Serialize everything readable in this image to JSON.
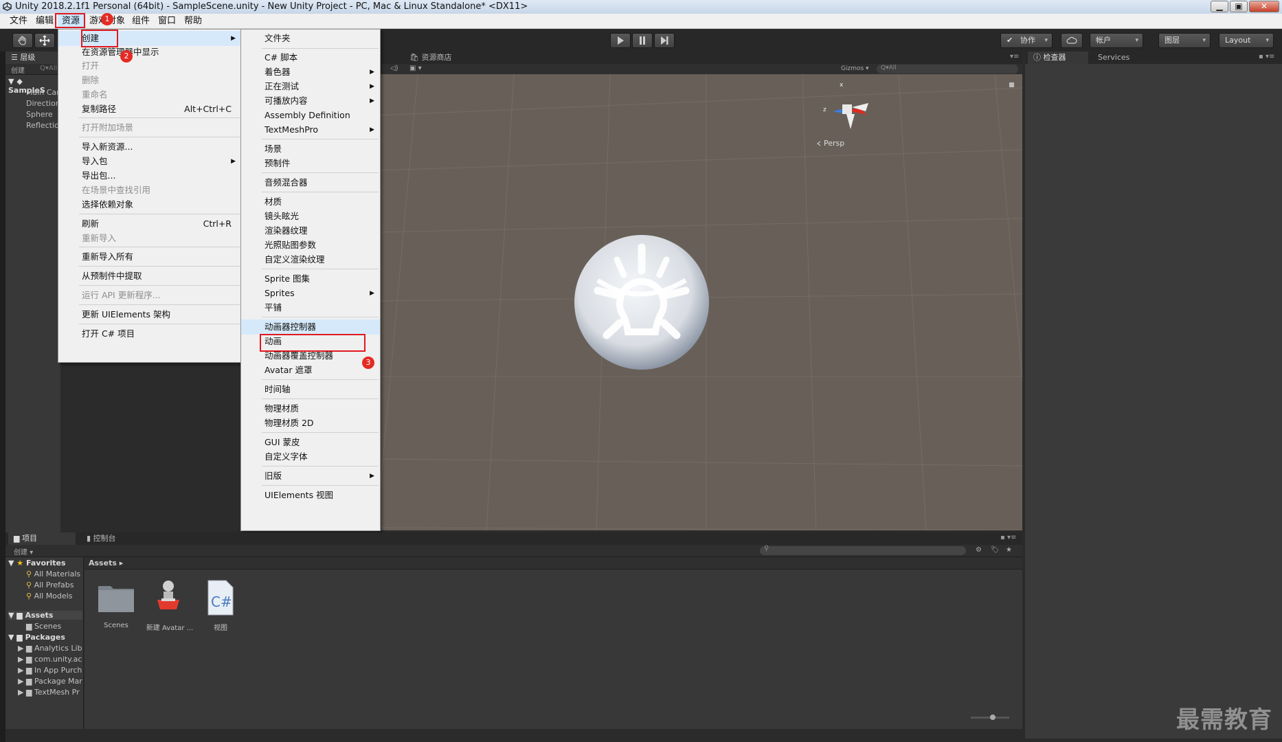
{
  "window": {
    "title": "Unity 2018.2.1f1 Personal (64bit) - SampleScene.unity - New Unity Project - PC, Mac & Linux Standalone* <DX11>",
    "minimize": "▁",
    "maximize": "▣",
    "close": "✕"
  },
  "menubar": [
    "文件",
    "编辑",
    "资源",
    "游戏对象",
    "组件",
    "窗口",
    "帮助"
  ],
  "toolbar": {
    "collab": "协作",
    "account": "帐户",
    "layers": "图层",
    "layout": "Layout"
  },
  "hierarchy": {
    "tab": "层级",
    "create": "创建",
    "search_placeholder": "Q▾All",
    "scene": "SampleS",
    "items": [
      "Main Car",
      "Direction",
      "Sphere",
      "Reflectio"
    ]
  },
  "scene_view": {
    "tab_store": "资源商店",
    "gizmos": "Gizmos",
    "search": "Q▾All",
    "persp": "Persp",
    "axis_x": "x",
    "axis_z": "z"
  },
  "inspector": {
    "tab": "检查器",
    "services": "Services"
  },
  "assets_menu": {
    "items": [
      {
        "label": "创建",
        "arrow": true
      },
      {
        "label": "在资源管理器中显示"
      },
      {
        "label": "打开",
        "disabled": true
      },
      {
        "label": "删除",
        "disabled": true
      },
      {
        "label": "重命名",
        "disabled": true
      },
      {
        "label": "复制路径",
        "shortcut": "Alt+Ctrl+C"
      },
      {
        "label": "打开附加场景",
        "disabled": true
      },
      {
        "label": "导入新资源..."
      },
      {
        "label": "导入包",
        "arrow": true
      },
      {
        "label": "导出包..."
      },
      {
        "label": "在场景中查找引用",
        "disabled": true
      },
      {
        "label": "选择依赖对象"
      },
      {
        "label": "刷新",
        "shortcut": "Ctrl+R"
      },
      {
        "label": "重新导入",
        "disabled": true
      },
      {
        "label": "重新导入所有"
      },
      {
        "label": "从预制件中提取"
      },
      {
        "label": "运行 API 更新程序...",
        "disabled": true
      },
      {
        "label": "更新 UIElements 架构"
      },
      {
        "label": "打开 C# 项目"
      }
    ]
  },
  "create_menu": {
    "items": [
      {
        "label": "文件夹"
      },
      {
        "label": "C# 脚本"
      },
      {
        "label": "着色器",
        "arrow": true
      },
      {
        "label": "正在测试",
        "arrow": true
      },
      {
        "label": "可播放内容",
        "arrow": true
      },
      {
        "label": "Assembly Definition"
      },
      {
        "label": "TextMeshPro",
        "arrow": true
      },
      {
        "label": "场景"
      },
      {
        "label": "预制件"
      },
      {
        "label": "音频混合器"
      },
      {
        "label": "材质"
      },
      {
        "label": "镜头眩光"
      },
      {
        "label": "渲染器纹理"
      },
      {
        "label": "光照贴图参数"
      },
      {
        "label": "自定义渲染纹理"
      },
      {
        "label": "Sprite 图集"
      },
      {
        "label": "Sprites",
        "arrow": true
      },
      {
        "label": "平铺"
      },
      {
        "label": "动画器控制器"
      },
      {
        "label": "动画"
      },
      {
        "label": "动画器覆盖控制器"
      },
      {
        "label": "Avatar 遮罩"
      },
      {
        "label": "时间轴"
      },
      {
        "label": "物理材质"
      },
      {
        "label": "物理材质 2D"
      },
      {
        "label": "GUI 蒙皮"
      },
      {
        "label": "自定义字体"
      },
      {
        "label": "旧版",
        "arrow": true
      },
      {
        "label": "UIElements 视图"
      }
    ]
  },
  "badges": [
    "1",
    "2",
    "3"
  ],
  "project": {
    "tab": "项目",
    "console_tab": "控制台",
    "create": "创建",
    "favorites": "Favorites",
    "fav_items": [
      "All Materials",
      "All Prefabs",
      "All Models"
    ],
    "assets": "Assets",
    "asset_children": [
      "Scenes"
    ],
    "packages": "Packages",
    "package_children": [
      "Analytics Lib",
      "com.unity.ac",
      "In App Purch",
      "Package Mar",
      "TextMesh Pr"
    ],
    "breadcrumb": "Assets ▸",
    "grid_items": [
      "Scenes",
      "新建 Avatar ...",
      "视图"
    ]
  },
  "watermark": "最需教育",
  "colors": {
    "highlight_red": "#e0191f",
    "scene_bg": "#686058",
    "menu_bg": "#f0f0f0",
    "editor_dark": "#383838"
  }
}
